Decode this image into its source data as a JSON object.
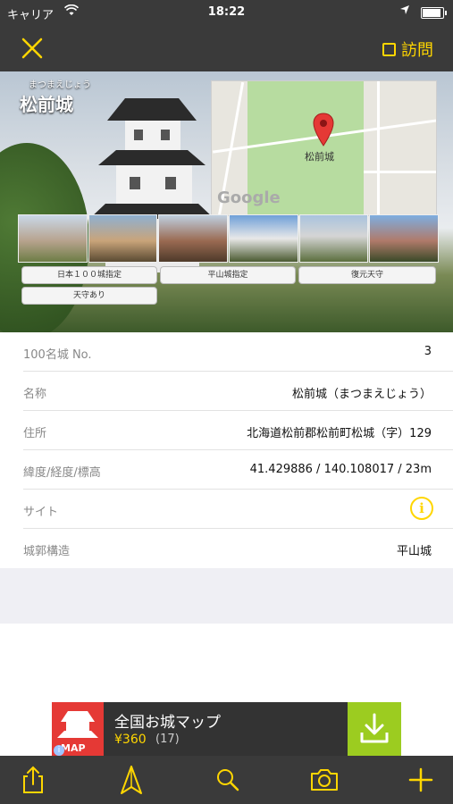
{
  "status": {
    "carrier": "キャリア",
    "time": "18:22",
    "battery_level": 0.9
  },
  "nav": {
    "visit_label": "訪問"
  },
  "castle": {
    "ruby": "まつまえじょう",
    "name": "松前城",
    "map_label": "松前城",
    "map_brand": "Google",
    "tags": [
      "日本１００城指定",
      "平山城指定",
      "復元天守",
      "天守あり"
    ]
  },
  "details": [
    {
      "label": "100名城 No.",
      "value": "3"
    },
    {
      "label": "名称",
      "value": "松前城（まつまえじょう）"
    },
    {
      "label": "住所",
      "value": "北海道松前郡松前町松城（字）129"
    },
    {
      "label": "緯度/経度/標高",
      "value": "41.429886 / 140.108017 / 23m"
    },
    {
      "label": "サイト",
      "value": ""
    },
    {
      "label": "城郭構造",
      "value": "平山城"
    }
  ],
  "ad": {
    "title": "全国お城マップ",
    "price": "¥360",
    "count": "(17)",
    "icon_text": "MAP"
  },
  "colors": {
    "accent": "#ffd600",
    "bar": "#3a3a3a",
    "ad_download": "#9ccc20",
    "ad_icon": "#e53935"
  },
  "icons": [
    "close-icon",
    "checkbox-icon",
    "map-pin-icon",
    "info-icon",
    "download-icon",
    "share-icon",
    "compass-icon",
    "search-icon",
    "camera-icon",
    "plus-icon"
  ]
}
